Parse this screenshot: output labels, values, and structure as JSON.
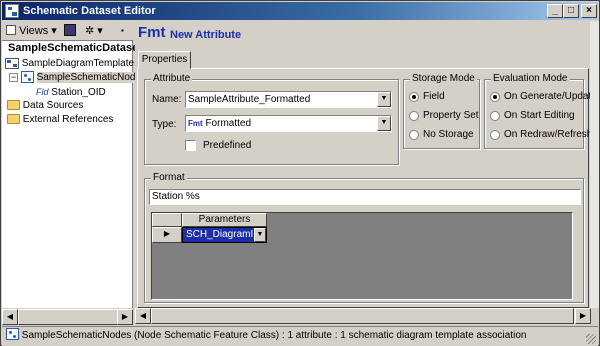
{
  "window": {
    "title": "Schematic Dataset Editor",
    "minimize": "_",
    "maximize": "□",
    "close": "×"
  },
  "toolbar": {
    "views_label": "Views",
    "views_arrow": "▾",
    "save_icon": "save-icon",
    "tools_arrow": "▾",
    "pin": "▪"
  },
  "tree": {
    "root": "SampleSchematicDataset",
    "items": [
      {
        "label": "SampleDiagramTemplate",
        "icon": "diagram-template-icon"
      },
      {
        "label": "SampleSchematicNodes",
        "icon": "node-feature-class-icon",
        "expander": "−"
      },
      {
        "label": "Station_OID",
        "prefix": "Fld",
        "icon": "field-icon"
      },
      {
        "label": "Data Sources",
        "icon": "folder-icon"
      },
      {
        "label": "External References",
        "icon": "folder-icon"
      }
    ]
  },
  "header": {
    "logo": "Fmt",
    "title": "New Attribute"
  },
  "tabs": [
    {
      "label": "Properties"
    }
  ],
  "attribute": {
    "group_label": "Attribute",
    "name_label": "Name:",
    "name_value": "SampleAttribute_Formatted",
    "type_label": "Type:",
    "type_prefix": "Fmt",
    "type_value": "Formatted",
    "predefined_label": "Predefined",
    "predefined_checked": false
  },
  "storage_mode": {
    "group_label": "Storage Mode",
    "options": [
      {
        "label": "Field",
        "checked": true
      },
      {
        "label": "Property Set",
        "checked": false
      },
      {
        "label": "No Storage",
        "checked": false
      }
    ]
  },
  "evaluation_mode": {
    "group_label": "Evaluation Mode",
    "options": [
      {
        "label": "On Generate/Update",
        "checked": true
      },
      {
        "label": "On Start Editing",
        "checked": false
      },
      {
        "label": "On Redraw/Refresh",
        "checked": false
      }
    ]
  },
  "format": {
    "group_label": "Format",
    "value": "Station %s",
    "grid_header": "Parameters",
    "row_marker": "▶",
    "param_value": "SCH_DiagramID"
  },
  "status_bar": {
    "text": "SampleSchematicNodes (Node Schematic Feature Class) : 1 attribute : 1 schematic diagram template association",
    "icon": "node-feature-class-icon"
  }
}
